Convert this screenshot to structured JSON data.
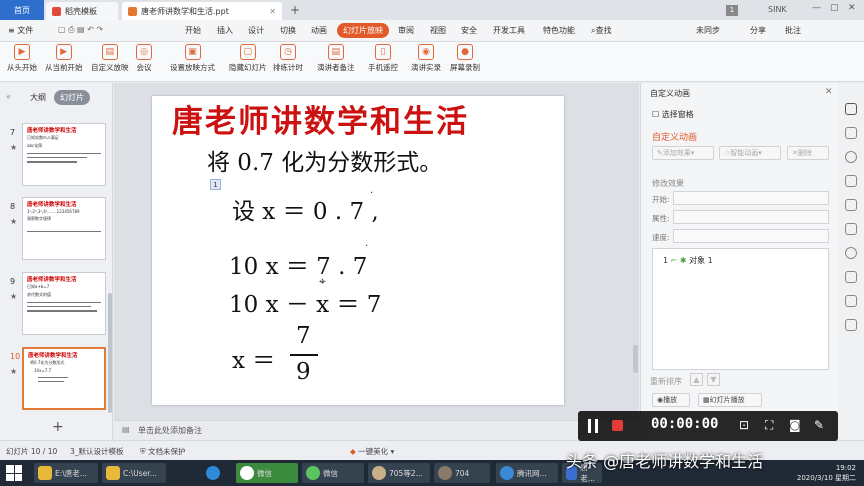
{
  "tabs": {
    "home": "首页",
    "template": "稻壳模板",
    "doc": "唐老师讲数学和生活.ppt",
    "page_badge": "1",
    "user": "SINK"
  },
  "menu": {
    "file": "文件",
    "items": [
      "开始",
      "插入",
      "设计",
      "切换",
      "动画",
      "幻灯片放映",
      "审阅",
      "视图",
      "安全",
      "开发工具",
      "特色功能"
    ],
    "search": "查找",
    "sync": "未同步",
    "share": "分享",
    "comment": "批注"
  },
  "ribbon": [
    "从头开始",
    "从当前开始",
    "自定义放映",
    "会议",
    "设置放映方式",
    "隐藏幻灯片",
    "排练计时",
    "演讲者备注",
    "手机遥控",
    "演讲实录",
    "屏幕录制"
  ],
  "left": {
    "outline": "大纲",
    "slides": "幻灯片"
  },
  "thumbs": [
    {
      "num": "7",
      "title": "唐老师讲数学和生活",
      "lines": [
        "已知实数m,n满足",
        "abc化简"
      ]
    },
    {
      "num": "8",
      "title": "唐老师讲数学和生活",
      "lines": [
        "1²,2²,3²,4²,……123456789",
        "观察数字规律"
      ]
    },
    {
      "num": "9",
      "title": "唐老师讲数学和生活",
      "lines": [
        "已知a+b=7",
        "求代数式的值"
      ]
    },
    {
      "num": "10",
      "title": "唐老师讲数学和生活",
      "lines": [
        "将0.7化为分数形式",
        "10x=7.7"
      ]
    }
  ],
  "slide": {
    "title": "唐老师讲数学和生活",
    "problem": "将  0.7  化为分数形式。",
    "anim_tag": "1",
    "line1": "设  x  ＝  0 . 7 ,",
    "line2": "10   x  ＝  7 . 7",
    "line3": "10   x  －  x  ＝  7",
    "line4_lhs": "x  ＝",
    "numerator": "7",
    "denominator": "9"
  },
  "notes": "单击此处添加备注",
  "panel": {
    "title": "自定义动画",
    "select_pane": "选择窗格",
    "custom_title": "自定义动画",
    "add": "添加效果",
    "smart": "智能动画",
    "delete": "删除",
    "modify": "修改效果",
    "start": "开始:",
    "property": "属性:",
    "speed": "速度:",
    "anim_item_num": "1",
    "anim_item": "对象 1",
    "reorder": "重新排序",
    "play": "播放",
    "slideshow": "幻灯片播放"
  },
  "status": {
    "slide": "幻灯片 10 / 10",
    "theme": "3_默认设计模板",
    "protect": "文档未保护",
    "beautify": "一键美化"
  },
  "recorder": {
    "time": "00:00:00"
  },
  "taskbar": {
    "items": [
      "E:\\唐老...",
      "C:\\User...",
      "",
      "微信",
      "微信",
      "705等2...",
      "704",
      "腾讯网...",
      "唐老...",
      "唐老..."
    ],
    "time": "19:02",
    "date": "2020/3/10 星期二"
  },
  "watermark": "头条 @唐老师讲数学和生活",
  "colors": {
    "accent": "#e05a2a",
    "title_red": "#cc1111",
    "home_blue": "#2e6fce"
  }
}
